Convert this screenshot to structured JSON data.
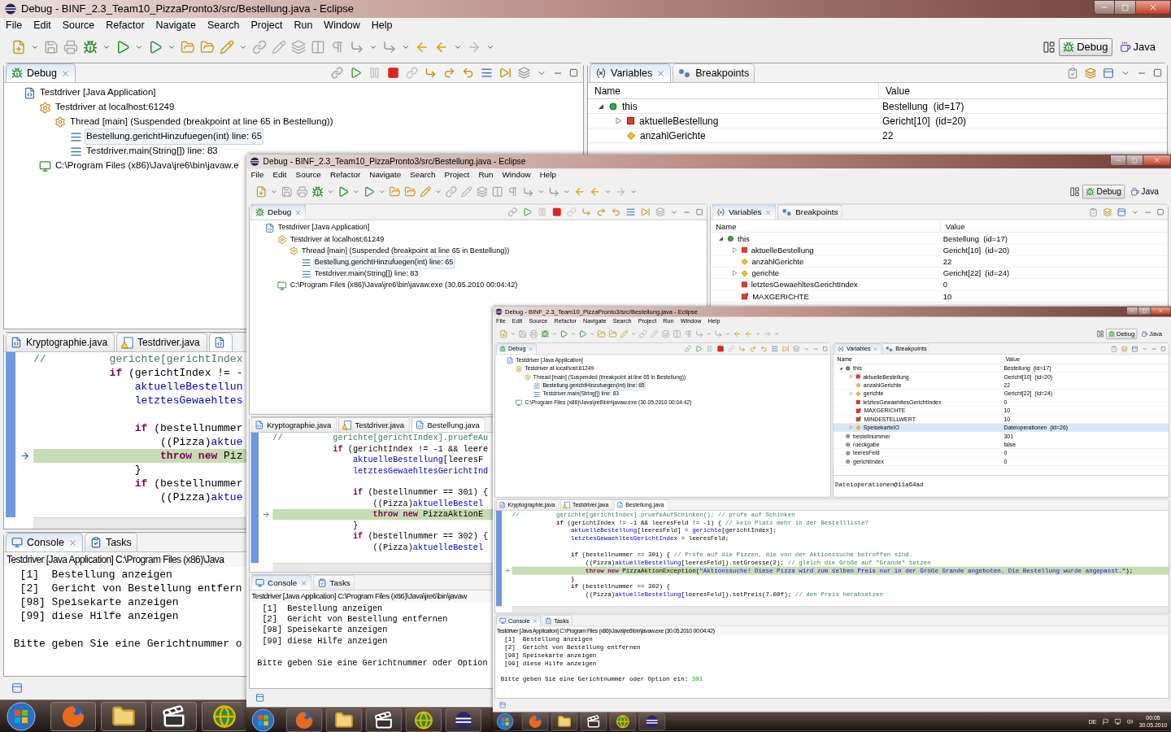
{
  "screens": [
    {
      "title": "Debug - BINF_2.3_Team10_PizzaPronto3/src/Bestellung.java - Eclipse",
      "menu": [
        "File",
        "Edit",
        "Source",
        "Refactor",
        "Navigate",
        "Search",
        "Project",
        "Run",
        "Window",
        "Help"
      ],
      "perspectives": [
        {
          "label": "Debug",
          "selected": true
        },
        {
          "label": "Java",
          "selected": false
        }
      ],
      "debug_view": {
        "tab": "Debug",
        "tree": [
          {
            "label": "Testdriver [Java Application]",
            "kind": "app",
            "selected": false,
            "children": [
              {
                "label": "Testdriver at localhost:61249",
                "kind": "target",
                "selected": false,
                "children": [
                  {
                    "label": "Thread [main] (Suspended (breakpoint at line 65 in Bestellung))",
                    "kind": "thread",
                    "selected": false,
                    "children": [
                      {
                        "label": "Bestellung.gerichtHinzufuegen(int) line: 65",
                        "kind": "frame",
                        "selected": true
                      },
                      {
                        "label": "Testdriver.main(String[]) line: 83",
                        "kind": "frame",
                        "selected": false
                      }
                    ]
                  }
                ]
              },
              {
                "label": "C:\\Program Files (x86)\\Java\\jre6\\bin\\javaw.e",
                "kind": "process",
                "selected": false
              }
            ]
          }
        ]
      },
      "variables_view": {
        "tabs": [
          {
            "label": "Variables",
            "kind": "variables",
            "selected": true
          },
          {
            "label": "Breakpoints",
            "kind": "breakpoints",
            "selected": false
          }
        ],
        "columns": [
          "Name",
          "Value"
        ],
        "rows": [
          {
            "name": "this",
            "value": "Bestellung  (id=17)",
            "kind": "object",
            "expanded": true,
            "selected": false,
            "children": [
              {
                "name": "aktuelleBestellung",
                "value": "Gericht[10]  (id=20)",
                "kind": "private",
                "expanded": false,
                "selected": false
              },
              {
                "name": "anzahlGerichte",
                "value": "22",
                "kind": "package",
                "selected": false
              }
            ]
          }
        ]
      },
      "editor": {
        "tabs": [
          {
            "label": "Kryptographie.java",
            "kind": "java",
            "selected": false
          },
          {
            "label": "Testdriver.java",
            "kind": "warning",
            "selected": false
          },
          {
            "kind": "java",
            "selected": true
          }
        ],
        "lines": [
          {
            "current": false,
            "segments": [
              {
                "text": "//          gerichte[gerichtIndex",
                "kind": "comment"
              }
            ]
          },
          {
            "current": false,
            "segments": [
              {
                "text": "            if",
                "kind": "keyword"
              },
              {
                "text": " (gerichtIndex != -",
                "kind": "plain"
              }
            ]
          },
          {
            "current": false,
            "segments": [
              {
                "text": "                aktuelleBestellun",
                "kind": "field"
              }
            ]
          },
          {
            "current": false,
            "segments": [
              {
                "text": "                letztesGewaehltes",
                "kind": "field"
              }
            ]
          },
          {
            "current": false
          },
          {
            "current": false,
            "segments": [
              {
                "text": "                if",
                "kind": "keyword"
              },
              {
                "text": " (bestellnummer",
                "kind": "plain"
              }
            ]
          },
          {
            "current": false,
            "segments": [
              {
                "text": "                    ((Pizza)",
                "kind": "plain"
              },
              {
                "text": "aktue",
                "kind": "field"
              }
            ]
          },
          {
            "current": true,
            "segments": [
              {
                "text": "                    throw new",
                "kind": "keyword"
              },
              {
                "text": " Piz",
                "kind": "plain"
              }
            ]
          },
          {
            "current": false,
            "segments": [
              {
                "text": "                }",
                "kind": "plain"
              }
            ]
          },
          {
            "current": false,
            "segments": [
              {
                "text": "                if",
                "kind": "keyword"
              },
              {
                "text": " (bestellnummer",
                "kind": "plain"
              }
            ]
          },
          {
            "current": false,
            "segments": [
              {
                "text": "                    ((Pizza)",
                "kind": "plain"
              },
              {
                "text": "aktue",
                "kind": "field"
              }
            ]
          }
        ]
      },
      "console": {
        "tabs": [
          {
            "label": "Console",
            "kind": "console",
            "selected": true
          },
          {
            "label": "Tasks",
            "kind": "tasks",
            "selected": false
          }
        ],
        "header": "Testdriver [Java Application] C:\\Program Files (x86)\\Java",
        "lines": [
          "  [1]  Bestellung anzeigen",
          "  [2]  Gericht von Bestellung entfern",
          "  [98] Speisekarte anzeigen",
          "  [99] diese Hilfe anzeigen"
        ],
        "prompt": " Bitte geben Sie eine Gerichtnummer o"
      },
      "taskbar": {
        "apps": [
          {
            "kind": "firefox"
          },
          {
            "kind": "folder"
          },
          {
            "kind": "media"
          },
          {
            "kind": "globe"
          }
        ]
      }
    },
    {
      "title": "Debug - BINF_2.3_Team10_PizzaPronto3/src/Bestellung.java - Eclipse",
      "menu": [
        "File",
        "Edit",
        "Source",
        "Refactor",
        "Navigate",
        "Search",
        "Project",
        "Run",
        "Window",
        "Help"
      ],
      "perspectives": [
        {
          "label": "Debug",
          "selected": true
        },
        {
          "label": "Java",
          "selected": false
        }
      ],
      "debug_view": {
        "tab": "Debug",
        "tree": [
          {
            "label": "Testdriver [Java Application]",
            "kind": "app",
            "selected": false,
            "children": [
              {
                "label": "Testdriver at localhost:61249",
                "kind": "target",
                "selected": false,
                "children": [
                  {
                    "label": "Thread [main] (Suspended (breakpoint at line 65 in Bestellung))",
                    "kind": "thread",
                    "selected": false,
                    "children": [
                      {
                        "label": "Bestellung.gerichtHinzufuegen(int) line: 65",
                        "kind": "frame",
                        "selected": true
                      },
                      {
                        "label": "Testdriver.main(String[]) line: 83",
                        "kind": "frame",
                        "selected": false
                      }
                    ]
                  }
                ]
              },
              {
                "label": "C:\\Program Files (x86)\\Java\\jre6\\bin\\javaw.exe (30.05.2010 00:04:42)",
                "kind": "process",
                "selected": false
              }
            ]
          }
        ]
      },
      "variables_view": {
        "tabs": [
          {
            "label": "Variables",
            "kind": "variables",
            "selected": true
          },
          {
            "label": "Breakpoints",
            "kind": "breakpoints",
            "selected": false
          }
        ],
        "columns": [
          "Name",
          "Value"
        ],
        "rows": [
          {
            "name": "this",
            "value": "Bestellung  (id=17)",
            "kind": "object",
            "expanded": true,
            "selected": false,
            "children": [
              {
                "name": "aktuelleBestellung",
                "value": "Gericht[10]  (id=20)",
                "kind": "private",
                "expanded": false,
                "selected": false
              },
              {
                "name": "anzahlGerichte",
                "value": "22",
                "kind": "package",
                "selected": false
              },
              {
                "name": "gerichte",
                "value": "Gericht[22]  (id=24)",
                "kind": "package",
                "expanded": false,
                "selected": false
              },
              {
                "name": "letztesGewaehltesGerichtIndex",
                "value": "0",
                "kind": "private",
                "selected": false
              },
              {
                "name": "MAXGERICHTE",
                "value": "10",
                "kind": "constant",
                "selected": false
              }
            ]
          }
        ]
      },
      "editor": {
        "tabs": [
          {
            "label": "Kryptographie.java",
            "kind": "java",
            "selected": false
          },
          {
            "label": "Testdriver.java",
            "kind": "warning",
            "selected": false
          },
          {
            "label": "Bestellung.java",
            "kind": "java",
            "selected": true
          }
        ],
        "lines": [
          {
            "current": false,
            "segments": [
              {
                "text": "//          gerichte[gerichtIndex].pruefeAu",
                "kind": "comment"
              }
            ]
          },
          {
            "current": false,
            "segments": [
              {
                "text": "            if",
                "kind": "keyword"
              },
              {
                "text": " (gerichtIndex != -1 && leere",
                "kind": "plain"
              }
            ]
          },
          {
            "current": false,
            "segments": [
              {
                "text": "                aktuelleBestellung",
                "kind": "field"
              },
              {
                "text": "[leeresF",
                "kind": "plain"
              }
            ]
          },
          {
            "current": false,
            "segments": [
              {
                "text": "                letztesGewaehltesGerichtInd",
                "kind": "field"
              }
            ]
          },
          {
            "current": false
          },
          {
            "current": false,
            "segments": [
              {
                "text": "                if",
                "kind": "keyword"
              },
              {
                "text": " (bestellnummer == 301) {",
                "kind": "plain"
              }
            ]
          },
          {
            "current": false,
            "segments": [
              {
                "text": "                    ((Pizza)",
                "kind": "plain"
              },
              {
                "text": "aktuelleBestel",
                "kind": "field"
              }
            ]
          },
          {
            "current": true,
            "segments": [
              {
                "text": "                    throw new",
                "kind": "keyword"
              },
              {
                "text": " PizzaAktionE",
                "kind": "plain"
              }
            ]
          },
          {
            "current": false,
            "segments": [
              {
                "text": "                }",
                "kind": "plain"
              }
            ]
          },
          {
            "current": false,
            "segments": [
              {
                "text": "                if",
                "kind": "keyword"
              },
              {
                "text": " (bestellnummer == 302) {",
                "kind": "plain"
              }
            ]
          },
          {
            "current": false,
            "segments": [
              {
                "text": "                    ((Pizza)",
                "kind": "plain"
              },
              {
                "text": "aktuelleBestel",
                "kind": "field"
              }
            ]
          }
        ]
      },
      "console": {
        "tabs": [
          {
            "label": "Console",
            "kind": "console",
            "selected": true
          },
          {
            "label": "Tasks",
            "kind": "tasks",
            "selected": false
          }
        ],
        "header": "Testdriver [Java Application] C:\\Program Files (x86)\\Java\\jre6\\bin\\javaw",
        "lines": [
          "  [1]  Bestellung anzeigen",
          "  [2]  Gericht von Bestellung entfernen",
          "  [98] Speisekarte anzeigen",
          "  [99] diese Hilfe anzeigen"
        ],
        "prompt": " Bitte geben Sie eine Gerichtnummer oder Option"
      },
      "taskbar": {
        "apps": [
          {
            "kind": "firefox"
          },
          {
            "kind": "folder"
          },
          {
            "kind": "media"
          },
          {
            "kind": "globe"
          },
          {
            "kind": "eclipse"
          }
        ]
      }
    },
    {
      "title": "Debug - BINF_2.3_Team10_PizzaPronto3/src/Bestellung.java - Eclipse",
      "menu": [
        "File",
        "Edit",
        "Source",
        "Refactor",
        "Navigate",
        "Search",
        "Project",
        "Run",
        "Window",
        "Help"
      ],
      "perspectives": [
        {
          "label": "Debug",
          "selected": true
        },
        {
          "label": "Java",
          "selected": false
        }
      ],
      "debug_view": {
        "tab": "Debug",
        "tree": [
          {
            "label": "Testdriver [Java Application]",
            "kind": "app",
            "selected": false,
            "children": [
              {
                "label": "Testdriver at localhost:61249",
                "kind": "target",
                "selected": false,
                "children": [
                  {
                    "label": "Thread [main] (Suspended (breakpoint at line 65 in Bestellung))",
                    "kind": "thread",
                    "selected": false,
                    "children": [
                      {
                        "label": "Bestellung.gerichtHinzufuegen(int) line: 65",
                        "kind": "frame",
                        "selected": true
                      },
                      {
                        "label": "Testdriver.main(String[]) line: 83",
                        "kind": "frame",
                        "selected": false
                      }
                    ]
                  }
                ]
              },
              {
                "label": "C:\\Program Files (x86)\\Java\\jre6\\bin\\javaw.exe (30.05.2010 00:04:42)",
                "kind": "process",
                "selected": false
              }
            ]
          }
        ]
      },
      "variables_view": {
        "tabs": [
          {
            "label": "Variables",
            "kind": "variables",
            "selected": true
          },
          {
            "label": "Breakpoints",
            "kind": "breakpoints",
            "selected": false
          }
        ],
        "columns": [
          "Name",
          "Value"
        ],
        "rows": [
          {
            "name": "this",
            "value": "Bestellung  (id=17)",
            "kind": "object",
            "expanded": true,
            "selected": false,
            "children": [
              {
                "name": "aktuelleBestellung",
                "value": "Gericht[10]  (id=20)",
                "kind": "private",
                "expanded": false,
                "selected": false
              },
              {
                "name": "anzahlGerichte",
                "value": "22",
                "kind": "package",
                "selected": false
              },
              {
                "name": "gerichte",
                "value": "Gericht[22]  (id=24)",
                "kind": "package",
                "expanded": false,
                "selected": false
              },
              {
                "name": "letztesGewaehltesGerichtIndex",
                "value": "0",
                "kind": "private",
                "selected": false
              },
              {
                "name": "MAXGERICHTE",
                "value": "10",
                "kind": "constant",
                "selected": false
              },
              {
                "name": "MINDESTELLWERT",
                "value": "10",
                "kind": "constant",
                "selected": false
              },
              {
                "name": "SpeisekarteIO",
                "value": "Dateioperationen  (id=26)",
                "kind": "package",
                "expanded": false,
                "selected": true
              }
            ]
          },
          {
            "name": "bestellnummer",
            "value": "301",
            "kind": "local",
            "selected": false
          },
          {
            "name": "rueckgabe",
            "value": "false",
            "kind": "local",
            "selected": false
          },
          {
            "name": "leeresFeld",
            "value": "0",
            "kind": "local",
            "selected": false
          },
          {
            "name": "gerichtIndex",
            "value": "0",
            "kind": "local",
            "selected": false
          }
        ],
        "detail": "Dateioperationen@11a64ad"
      },
      "editor": {
        "tabs": [
          {
            "label": "Kryptographie.java",
            "kind": "java",
            "selected": false
          },
          {
            "label": "Testdriver.java",
            "kind": "warning",
            "selected": false
          },
          {
            "label": "Bestellung.java",
            "kind": "java",
            "selected": true
          }
        ],
        "lines": [
          {
            "current": false,
            "segments": [
              {
                "text": "//          gerichte[gerichtIndex].pruefeAufSchinken(); // prüfe auf Schinken",
                "kind": "comment"
              }
            ]
          },
          {
            "current": false,
            "segments": [
              {
                "text": "            if",
                "kind": "keyword"
              },
              {
                "text": " (gerichtIndex != -1 && leeresFeld != -1) { ",
                "kind": "plain"
              },
              {
                "text": "// kein Platz mehr in der Bestellliste?",
                "kind": "comment"
              }
            ]
          },
          {
            "current": false,
            "segments": [
              {
                "text": "                aktuelleBestellung",
                "kind": "field"
              },
              {
                "text": "[leeresFeld] = ",
                "kind": "plain"
              },
              {
                "text": "gerichte",
                "kind": "field"
              },
              {
                "text": "[gerichtIndex];",
                "kind": "plain"
              }
            ]
          },
          {
            "current": false,
            "segments": [
              {
                "text": "                letztesGewaehltesGerichtIndex",
                "kind": "field"
              },
              {
                "text": " = leeresFeld;",
                "kind": "plain"
              }
            ]
          },
          {
            "current": false
          },
          {
            "current": false,
            "segments": [
              {
                "text": "                if",
                "kind": "keyword"
              },
              {
                "text": " (bestellnummer == 301) { ",
                "kind": "plain"
              },
              {
                "text": "// Prüfe auf die Pizzen, die von der Aktionssuche betroffen sind.",
                "kind": "comment"
              }
            ]
          },
          {
            "current": false,
            "segments": [
              {
                "text": "                    ((Pizza)",
                "kind": "plain"
              },
              {
                "text": "aktuelleBestellung",
                "kind": "field"
              },
              {
                "text": "[leeresFeld]).setGroesse(2); ",
                "kind": "plain"
              },
              {
                "text": "// gleich die Größe auf \"Grande\" setzen",
                "kind": "comment"
              }
            ]
          },
          {
            "current": true,
            "segments": [
              {
                "text": "                    throw new",
                "kind": "keyword"
              },
              {
                "text": " PizzaAktionException(",
                "kind": "plain"
              },
              {
                "text": "\"Aktionssuche! Diese Pizza wird zum selben Preis nur in der Größe Grande angeboten. Die Bestellung wurde angepasst.\"",
                "kind": "string"
              },
              {
                "text": ");",
                "kind": "plain"
              }
            ]
          },
          {
            "current": false,
            "segments": [
              {
                "text": "                }",
                "kind": "plain"
              }
            ]
          },
          {
            "current": false,
            "segments": [
              {
                "text": "                if",
                "kind": "keyword"
              },
              {
                "text": " (bestellnummer == 302) {",
                "kind": "plain"
              }
            ]
          },
          {
            "current": false,
            "segments": [
              {
                "text": "                    ((Pizza)",
                "kind": "plain"
              },
              {
                "text": "aktuelleBestellung",
                "kind": "field"
              },
              {
                "text": "[leeresFeld]).setPreis(7.00f); ",
                "kind": "plain"
              },
              {
                "text": "// den Preis herabsetzen",
                "kind": "comment"
              }
            ]
          }
        ]
      },
      "console": {
        "tabs": [
          {
            "label": "Console",
            "kind": "console",
            "selected": true
          },
          {
            "label": "Tasks",
            "kind": "tasks",
            "selected": false
          }
        ],
        "header": "Testdriver [Java Application] C:\\Program Files (x86)\\Java\\jre6\\bin\\javaw.exe (30.05.2010 00:04:42)",
        "lines": [
          "  [1]  Bestellung anzeigen",
          "  [2]  Gericht von Bestellung entfernen",
          "  [98] Speisekarte anzeigen",
          "  [99] diese Hilfe anzeigen"
        ],
        "prompt": " Bitte geben Sie eine Gerichtnummer oder Option ein:",
        "input": "301"
      },
      "taskbar": {
        "apps": [
          {
            "kind": "firefox"
          },
          {
            "kind": "folder"
          },
          {
            "kind": "media"
          },
          {
            "kind": "globe"
          },
          {
            "kind": "eclipse"
          }
        ],
        "tray": {
          "language": "DE",
          "time": "00:05",
          "date": "30.05.2010"
        }
      }
    }
  ]
}
